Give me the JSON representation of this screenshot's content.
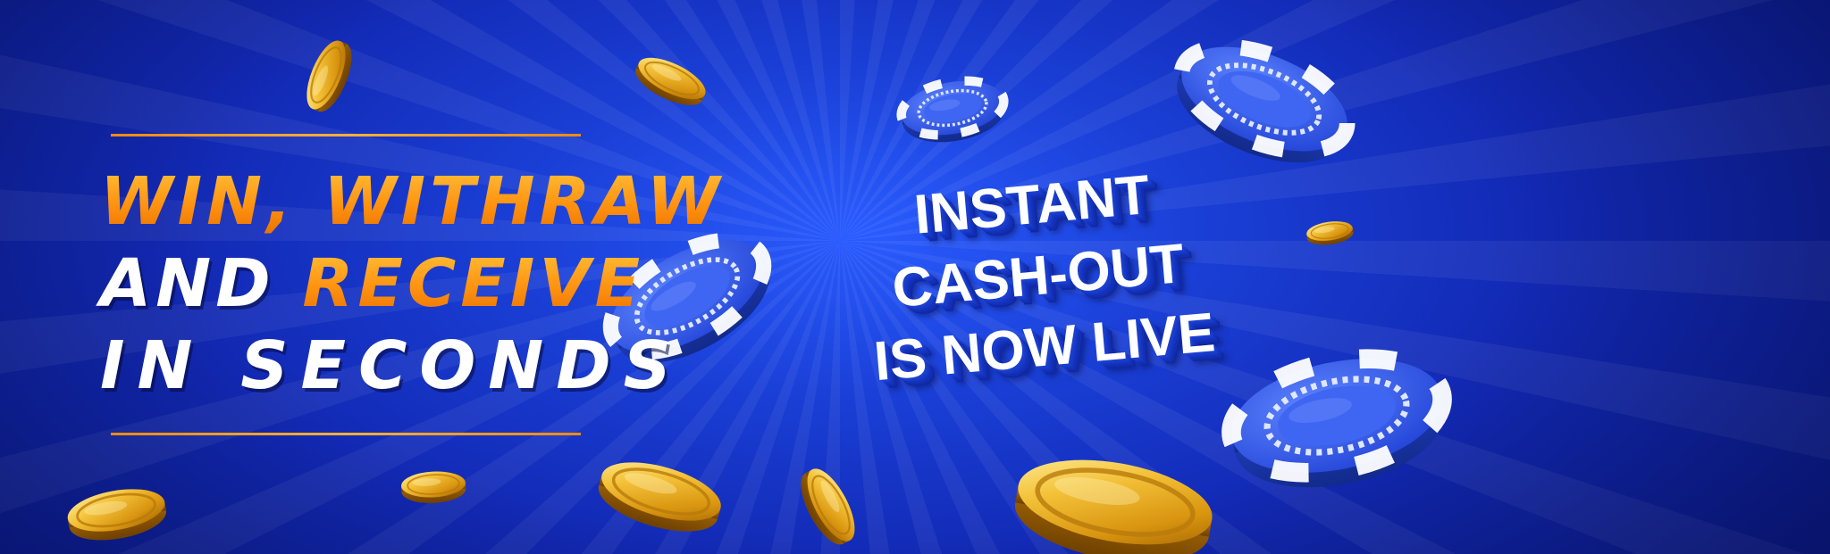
{
  "headline": {
    "line1_a": "WIN,",
    "line1_b": "WITHRAW",
    "line2_a": "AND",
    "line2_b": "RECEIVE",
    "line3": "IN SECONDS"
  },
  "tagline": {
    "line1": "INSTANT",
    "line2": "CASH-OUT",
    "line3": "IS NOW LIVE"
  },
  "colors": {
    "background": "#1a3fd6",
    "accent_orange": "#ff9a14",
    "text_white": "#ffffff",
    "chip_blue": "#2f5bf0",
    "coin_gold": "#e9a81c"
  },
  "decorations": {
    "coin_icon": "gold-coin-icon",
    "chip_icon": "poker-chip-icon"
  }
}
